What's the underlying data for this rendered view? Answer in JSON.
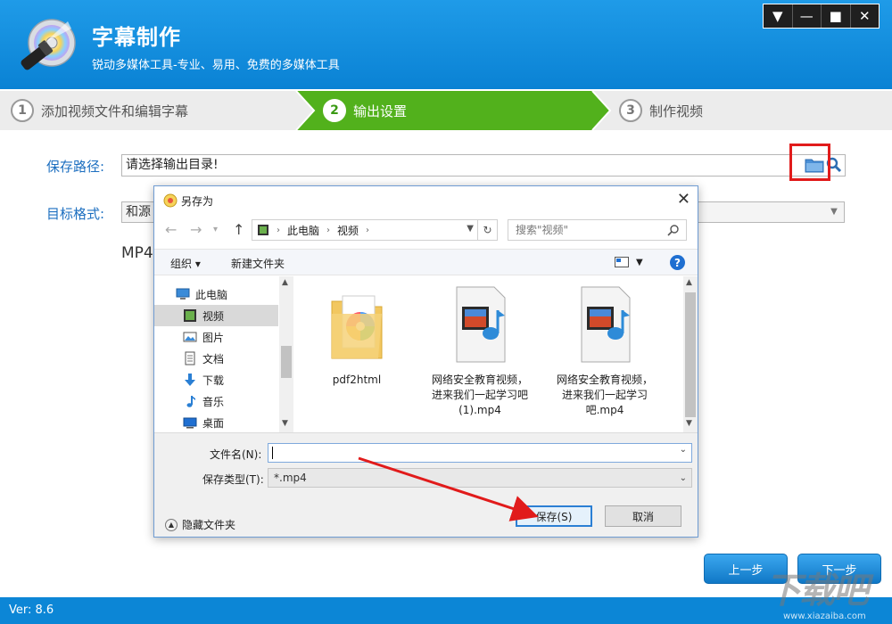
{
  "app": {
    "title": "字幕制作",
    "subtitle": "锐动多媒体工具-专业、易用、免费的多媒体工具",
    "version": "Ver: 8.6"
  },
  "window_controls": {
    "menu": "▼",
    "minimize": "—",
    "maximize": "■",
    "close": "✕"
  },
  "steps": [
    {
      "num": "1",
      "label": "添加视频文件和编辑字幕",
      "active": false
    },
    {
      "num": "2",
      "label": "输出设置",
      "active": true
    },
    {
      "num": "3",
      "label": "制作视频",
      "active": false
    }
  ],
  "form": {
    "save_path_label": "保存路径:",
    "save_path_value": "请选择输出目录!",
    "target_format_label": "目标格式:",
    "target_format_value": "和源",
    "format_name": "MP4"
  },
  "nav": {
    "prev": "上一步",
    "next": "下一步"
  },
  "watermark": {
    "text": "下载吧",
    "url": "www.xiazaiba.com"
  },
  "dialog": {
    "title": "另存为",
    "close": "✕",
    "address": [
      "此电脑",
      "视频"
    ],
    "search_placeholder": "搜索\"视频\"",
    "toolbar": {
      "organize": "组织 ▾",
      "new_folder": "新建文件夹",
      "help": "?"
    },
    "tree": [
      {
        "label": "此电脑",
        "icon": "computer-icon",
        "selected": false
      },
      {
        "label": "视频",
        "icon": "video-folder-icon",
        "selected": true
      },
      {
        "label": "图片",
        "icon": "pictures-icon",
        "selected": false
      },
      {
        "label": "文档",
        "icon": "documents-icon",
        "selected": false
      },
      {
        "label": "下载",
        "icon": "download-icon",
        "selected": false
      },
      {
        "label": "音乐",
        "icon": "music-icon",
        "selected": false
      },
      {
        "label": "桌面",
        "icon": "desktop-icon",
        "selected": false
      }
    ],
    "files": [
      {
        "name": "pdf2html",
        "type": "folder"
      },
      {
        "name": "网络安全教育视频，进来我们一起学习吧(1).mp4",
        "type": "mp4"
      },
      {
        "name": "网络安全教育视频，进来我们一起学习吧.mp4",
        "type": "mp4"
      }
    ],
    "filename_label": "文件名(N):",
    "filename_value": "",
    "filetype_label": "保存类型(T):",
    "filetype_value": "*.mp4",
    "hide_folders": "隐藏文件夹",
    "save_button": "保存(S)",
    "cancel_button": "取消"
  },
  "colors": {
    "header": "#0a82d4",
    "active_step": "#4caf17",
    "highlight": "#e11b1b",
    "footer": "#0c86d6"
  }
}
